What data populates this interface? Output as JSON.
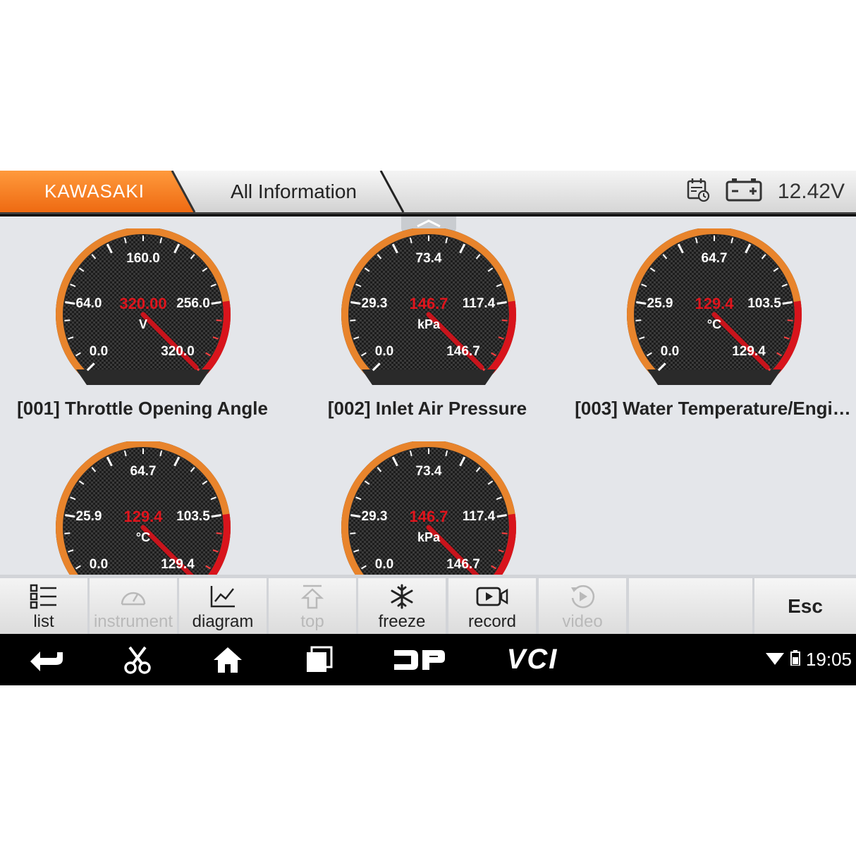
{
  "header": {
    "brand": "KAWASAKI",
    "section": "All Information",
    "voltage": "12.42V",
    "colors": {
      "brand_tab": "#f57c1f",
      "header_bg": "#e6e6e6"
    },
    "icons": [
      "calendar-clock-icon",
      "battery-icon"
    ]
  },
  "gauges": [
    {
      "title": "[001] Throttle Opening Angle",
      "value": "320.00",
      "unit": "V",
      "ticks": {
        "top": "160.0",
        "upper_left": "64.0",
        "upper_right": "256.0",
        "lower_left": "0.0",
        "lower_right": "320.0"
      },
      "fraction": 1.0
    },
    {
      "title": "[002] Inlet Air Pressure",
      "value": "146.7",
      "unit": "kPa",
      "ticks": {
        "top": "73.4",
        "upper_left": "29.3",
        "upper_right": "117.4",
        "lower_left": "0.0",
        "lower_right": "146.7"
      },
      "fraction": 1.0
    },
    {
      "title": "[003] Water Temperature/Engi…",
      "value": "129.4",
      "unit": "°C",
      "ticks": {
        "top": "64.7",
        "upper_left": "25.9",
        "upper_right": "103.5",
        "lower_left": "0.0",
        "lower_right": "129.4"
      },
      "fraction": 1.0
    },
    {
      "title": "",
      "value": "129.4",
      "unit": "°C",
      "ticks": {
        "top": "64.7",
        "upper_left": "25.9",
        "upper_right": "103.5",
        "lower_left": "0.0",
        "lower_right": "129.4"
      },
      "fraction": 1.0
    },
    {
      "title": "",
      "value": "146.7",
      "unit": "kPa",
      "ticks": {
        "top": "73.4",
        "upper_left": "29.3",
        "upper_right": "117.4",
        "lower_left": "0.0",
        "lower_right": "146.7"
      },
      "fraction": 1.0
    }
  ],
  "toolbar": {
    "list": "list",
    "instrument": "instrument",
    "diagram": "diagram",
    "top": "top",
    "freeze": "freeze",
    "record": "record",
    "video": "video",
    "esc": "Esc"
  },
  "navbar": {
    "dp": "DP",
    "vci": "VCI",
    "time": "19:05",
    "icons": [
      "back-icon",
      "scissors-icon",
      "home-icon",
      "recent-apps-icon",
      "wifi-icon",
      "battery-icon"
    ]
  }
}
